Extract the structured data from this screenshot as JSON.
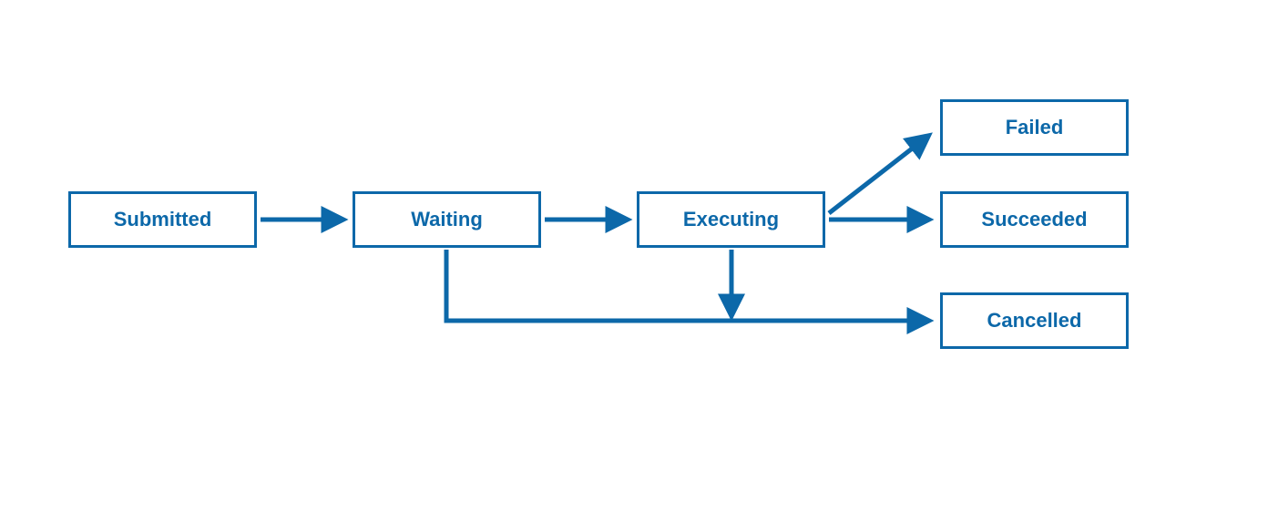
{
  "diagram": {
    "type": "state-transition",
    "color": "#0c68a9",
    "nodes": {
      "submitted": {
        "label": "Submitted"
      },
      "waiting": {
        "label": "Waiting"
      },
      "executing": {
        "label": "Executing"
      },
      "failed": {
        "label": "Failed"
      },
      "succeeded": {
        "label": "Succeeded"
      },
      "cancelled": {
        "label": "Cancelled"
      }
    },
    "transitions": [
      {
        "from": "submitted",
        "to": "waiting"
      },
      {
        "from": "waiting",
        "to": "executing"
      },
      {
        "from": "executing",
        "to": "failed"
      },
      {
        "from": "executing",
        "to": "succeeded"
      },
      {
        "from": "waiting",
        "to": "cancelled"
      },
      {
        "from": "executing",
        "to": "cancelled"
      }
    ]
  }
}
